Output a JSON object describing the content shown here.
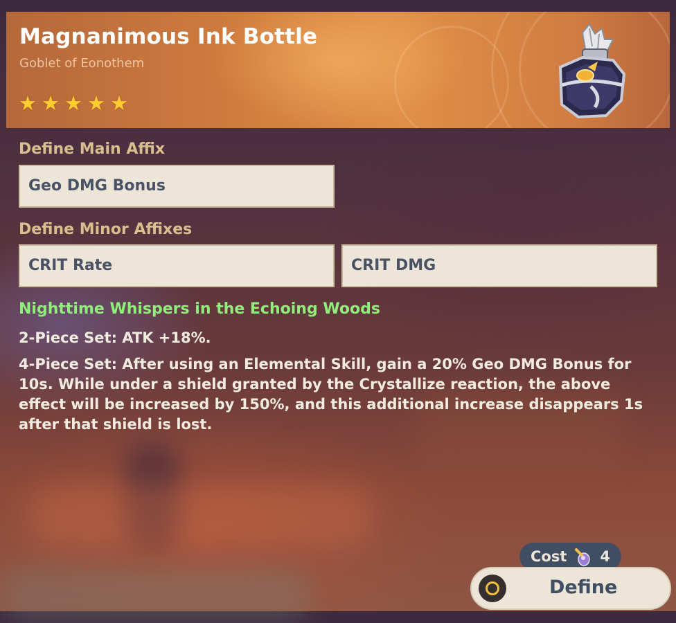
{
  "artifact": {
    "name": "Magnanimous Ink Bottle",
    "type": "Goblet of Eonothem",
    "rarity": 5,
    "stars": [
      "★",
      "★",
      "★",
      "★",
      "★"
    ],
    "icon": "ink-bottle-goblet-icon"
  },
  "main_affix": {
    "label": "Define Main Affix",
    "value": "Geo DMG Bonus"
  },
  "minor_affixes": {
    "label": "Define Minor Affixes",
    "values": [
      "CRIT Rate",
      "CRIT DMG"
    ]
  },
  "set": {
    "name": "Nighttime Whispers in the Echoing Woods",
    "two_piece": "2-Piece Set: ATK +18%.",
    "four_piece": "4-Piece Set: After using an Elemental Skill, gain a 20% Geo DMG Bonus for 10s. While under a shield granted by the Crystallize reaction, the above effect will be increased by 150%, and this additional increase disappears 1s after that shield is lost."
  },
  "cost": {
    "label": "Cost",
    "amount": "4",
    "item_icon": "sanctifying-elixir-icon"
  },
  "define_button": {
    "label": "Define",
    "icon": "confirm-circle-icon"
  },
  "colors": {
    "header_orange": "#d07c3e",
    "set_name_green": "#8fef7a",
    "box_fill": "#ece5d8",
    "button_text": "#3f4e63",
    "label_gold": "#d9bf8e",
    "star_gold": "#ffcc32"
  }
}
